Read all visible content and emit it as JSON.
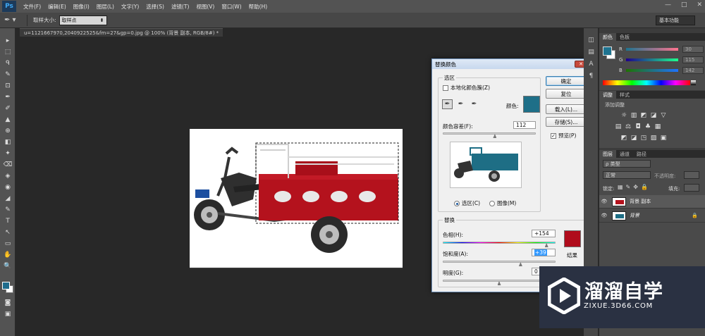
{
  "app": {
    "logo": "Ps",
    "menu": [
      "文件(F)",
      "编辑(E)",
      "图像(I)",
      "图层(L)",
      "文字(Y)",
      "选择(S)",
      "滤镜(T)",
      "视图(V)",
      "窗口(W)",
      "帮助(H)"
    ]
  },
  "window_controls": {
    "minimize": "—",
    "maximize": "□",
    "close": "✕"
  },
  "options": {
    "sample_size_label": "取样大小:",
    "sample_size_value": "取样点",
    "workspace": "基本功能"
  },
  "document": {
    "tab": "u=1121667970,2040922525&fm=27&gp=0.jpg @ 100% (背景 副本, RGB/8#) *"
  },
  "tools": [
    "▸",
    "⬚",
    "ᑫ",
    "✎",
    "⊡",
    "✒",
    "✐",
    "▲",
    "⊕",
    "◧",
    "✦",
    "⌫",
    "◈",
    "◉",
    "◢",
    "✎",
    "T",
    "↖",
    "▭",
    "✋",
    "🔍"
  ],
  "dialog": {
    "title": "替换颜色",
    "close": "✕",
    "selection_group": "选区",
    "localized_clusters": "本地化颜色簇(Z)",
    "color_label": "颜色:",
    "selection_color": "#1e6f88",
    "fuzziness_label": "颜色容差(F):",
    "fuzziness_value": "112",
    "fuzziness_level": 0.56,
    "radio_selection": "选区(C)",
    "radio_image": "图像(M)",
    "replacement_group": "替换",
    "hue_label": "色相(H):",
    "hue_value": "+154",
    "hue_level": 0.92,
    "saturation_label": "饱和度(A):",
    "saturation_value": "+39",
    "saturation_level": 0.69,
    "lightness_label": "明度(G):",
    "lightness_value": "0",
    "lightness_level": 0.5,
    "result_label": "结果",
    "result_color": "#b00c1c",
    "buttons": {
      "ok": "确定",
      "reset": "复位",
      "load": "载入(L)...",
      "save": "存储(S)..."
    },
    "preview_label": "预览(P)"
  },
  "panels": {
    "color_tabs": [
      "颜色",
      "色板"
    ],
    "color_rows": [
      {
        "label": "R",
        "value": "30"
      },
      {
        "label": "G",
        "value": "115"
      },
      {
        "label": "B",
        "value": "142"
      }
    ],
    "fg_swatch": "#1e7390",
    "adjust_tabs": [
      "调整",
      "样式"
    ],
    "adjust_title": "添加调整",
    "adjust_icons_row1": [
      "☼",
      "▥",
      "◩",
      "◪",
      "▽"
    ],
    "adjust_icons_row2": [
      "▤",
      "⚖",
      "◘",
      "♣",
      "▦"
    ],
    "adjust_icons_row3": [
      "◩",
      "◪",
      "◳",
      "▨",
      "▣"
    ],
    "layers_tabs": [
      "图层",
      "通道",
      "路径"
    ],
    "layer_kind": "ρ 类型",
    "blend_mode": "正常",
    "opacity_label": "不透明度:",
    "lock_label": "锁定:",
    "fill_label": "填充:",
    "layers": [
      {
        "name": "背景 副本",
        "selected": true
      },
      {
        "name": "背景",
        "selected": false
      }
    ]
  },
  "watermark": {
    "title": "溜溜自学",
    "url": "ZIXUE.3D66.COM"
  }
}
